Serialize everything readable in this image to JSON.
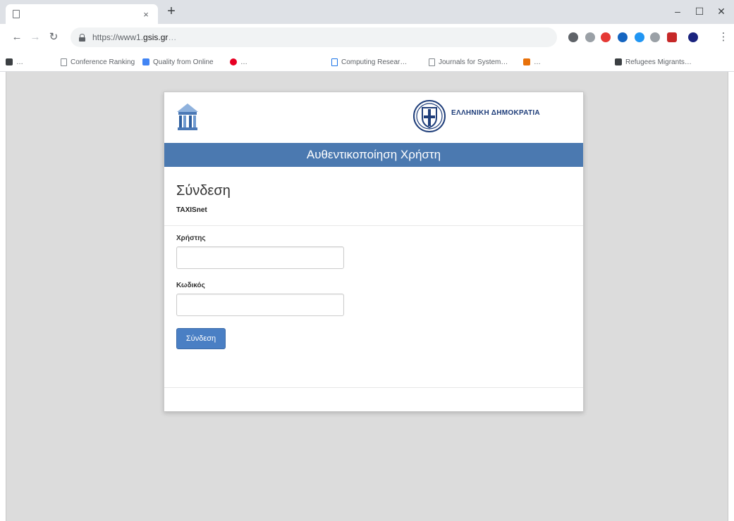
{
  "browser": {
    "tab": {
      "title": "",
      "close": "×"
    },
    "new_tab": "+",
    "window_controls": {
      "minimize": "–",
      "maximize": "☐",
      "close": "✕"
    },
    "nav": {
      "back": "←",
      "forward": "→",
      "reload": "↻"
    },
    "url": {
      "prefix": "https://www1.",
      "host": "gsis.gr",
      "path": "…"
    },
    "bookmarks": [
      {
        "label": "…",
        "icon": "folder-icon",
        "color": "#3c4043"
      },
      {
        "label": "Conference Ranking",
        "icon": "page-icon",
        "color": "#80868b"
      },
      {
        "label": "Quality from Online",
        "icon": "chart-icon",
        "color": "#4285f4"
      },
      {
        "label": "…",
        "icon": "pinterest-icon",
        "color": "#e60023"
      },
      {
        "label": "Computing Resear…",
        "icon": "page-icon",
        "color": "#1a73e8"
      },
      {
        "label": "Journals for System…",
        "icon": "page-icon",
        "color": "#80868b"
      },
      {
        "label": "…",
        "icon": "bookmark-icon",
        "color": "#e8710a"
      },
      {
        "label": "Refugees Migrants…",
        "icon": "bookmark-icon",
        "color": "#3c4043"
      }
    ],
    "extension_colors": [
      "#5f6368",
      "#9aa0a6",
      "#e53935",
      "#1565c0",
      "#2196f3",
      "#9aa0a6",
      "#c62828",
      "#1a237e"
    ]
  },
  "header": {
    "gsis_line1": "",
    "gsis_line2": "",
    "state_title": "ΕΛΛΗΝΙΚΗ ΔΗΜΟΚΡΑΤΙΑ",
    "ministry": ""
  },
  "auth_bar": {
    "title": "Αυθεντικοποίηση Χρήστη"
  },
  "login": {
    "heading": "Σύνδεση",
    "intro_before": "",
    "intro_brand": "TAXISnet",
    "intro_after": "",
    "username_label": "Χρήστης",
    "username_value": "",
    "password_label": "Κωδικός",
    "password_value": "",
    "submit_label": "Σύνδεση"
  },
  "footer": {
    "text": ""
  },
  "colors": {
    "accent_bar": "#4b79b0",
    "button": "#4a7fc4",
    "page_background": "#dcdcdc",
    "state_title": "#1f3e7a"
  }
}
